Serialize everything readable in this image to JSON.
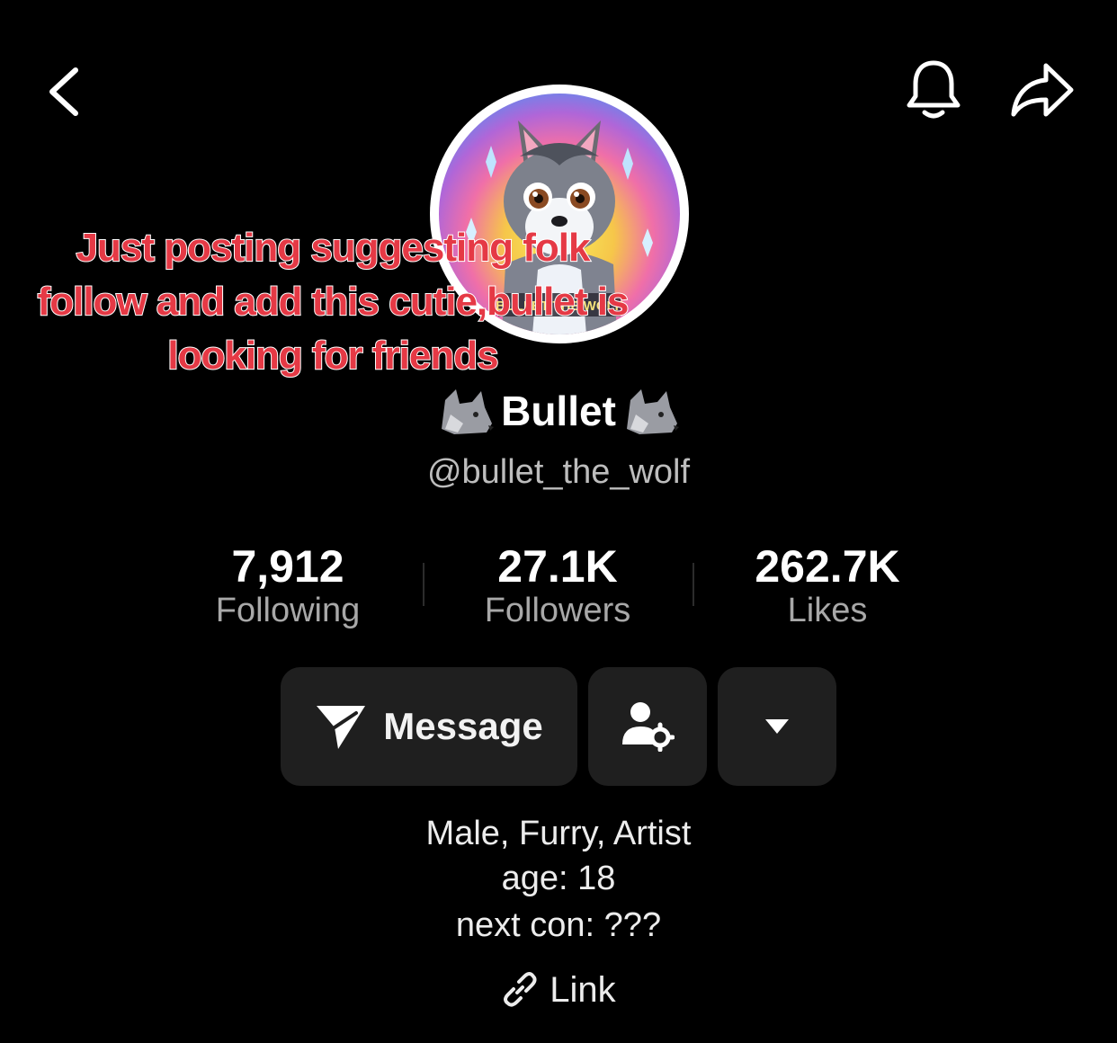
{
  "header": {
    "back_icon": "chevron-left-icon",
    "notification_icon": "bell-icon",
    "share_icon": "share-arrow-icon"
  },
  "profile": {
    "display_name": "Bullet",
    "name_emoji": "wolf-emoji",
    "username": "@bullet_the_wolf",
    "avatar_text": "BULLET THE WOLF"
  },
  "stats": [
    {
      "value": "7,912",
      "label": "Following"
    },
    {
      "value": "27.1K",
      "label": "Followers"
    },
    {
      "value": "262.7K",
      "label": "Likes"
    }
  ],
  "actions": {
    "message_label": "Message",
    "message_icon": "paper-plane-icon",
    "friends_icon": "person-settings-icon",
    "more_icon": "caret-down-icon"
  },
  "bio": {
    "line1": "Male, Furry, Artist",
    "line2": "age: 18",
    "line3": "next con: ???"
  },
  "link": {
    "label": "Link",
    "icon": "link-icon"
  },
  "overlay": {
    "caption": "Just posting suggesting folk follow and add this cutie,bullet is looking for friends",
    "color": "#e53945"
  }
}
